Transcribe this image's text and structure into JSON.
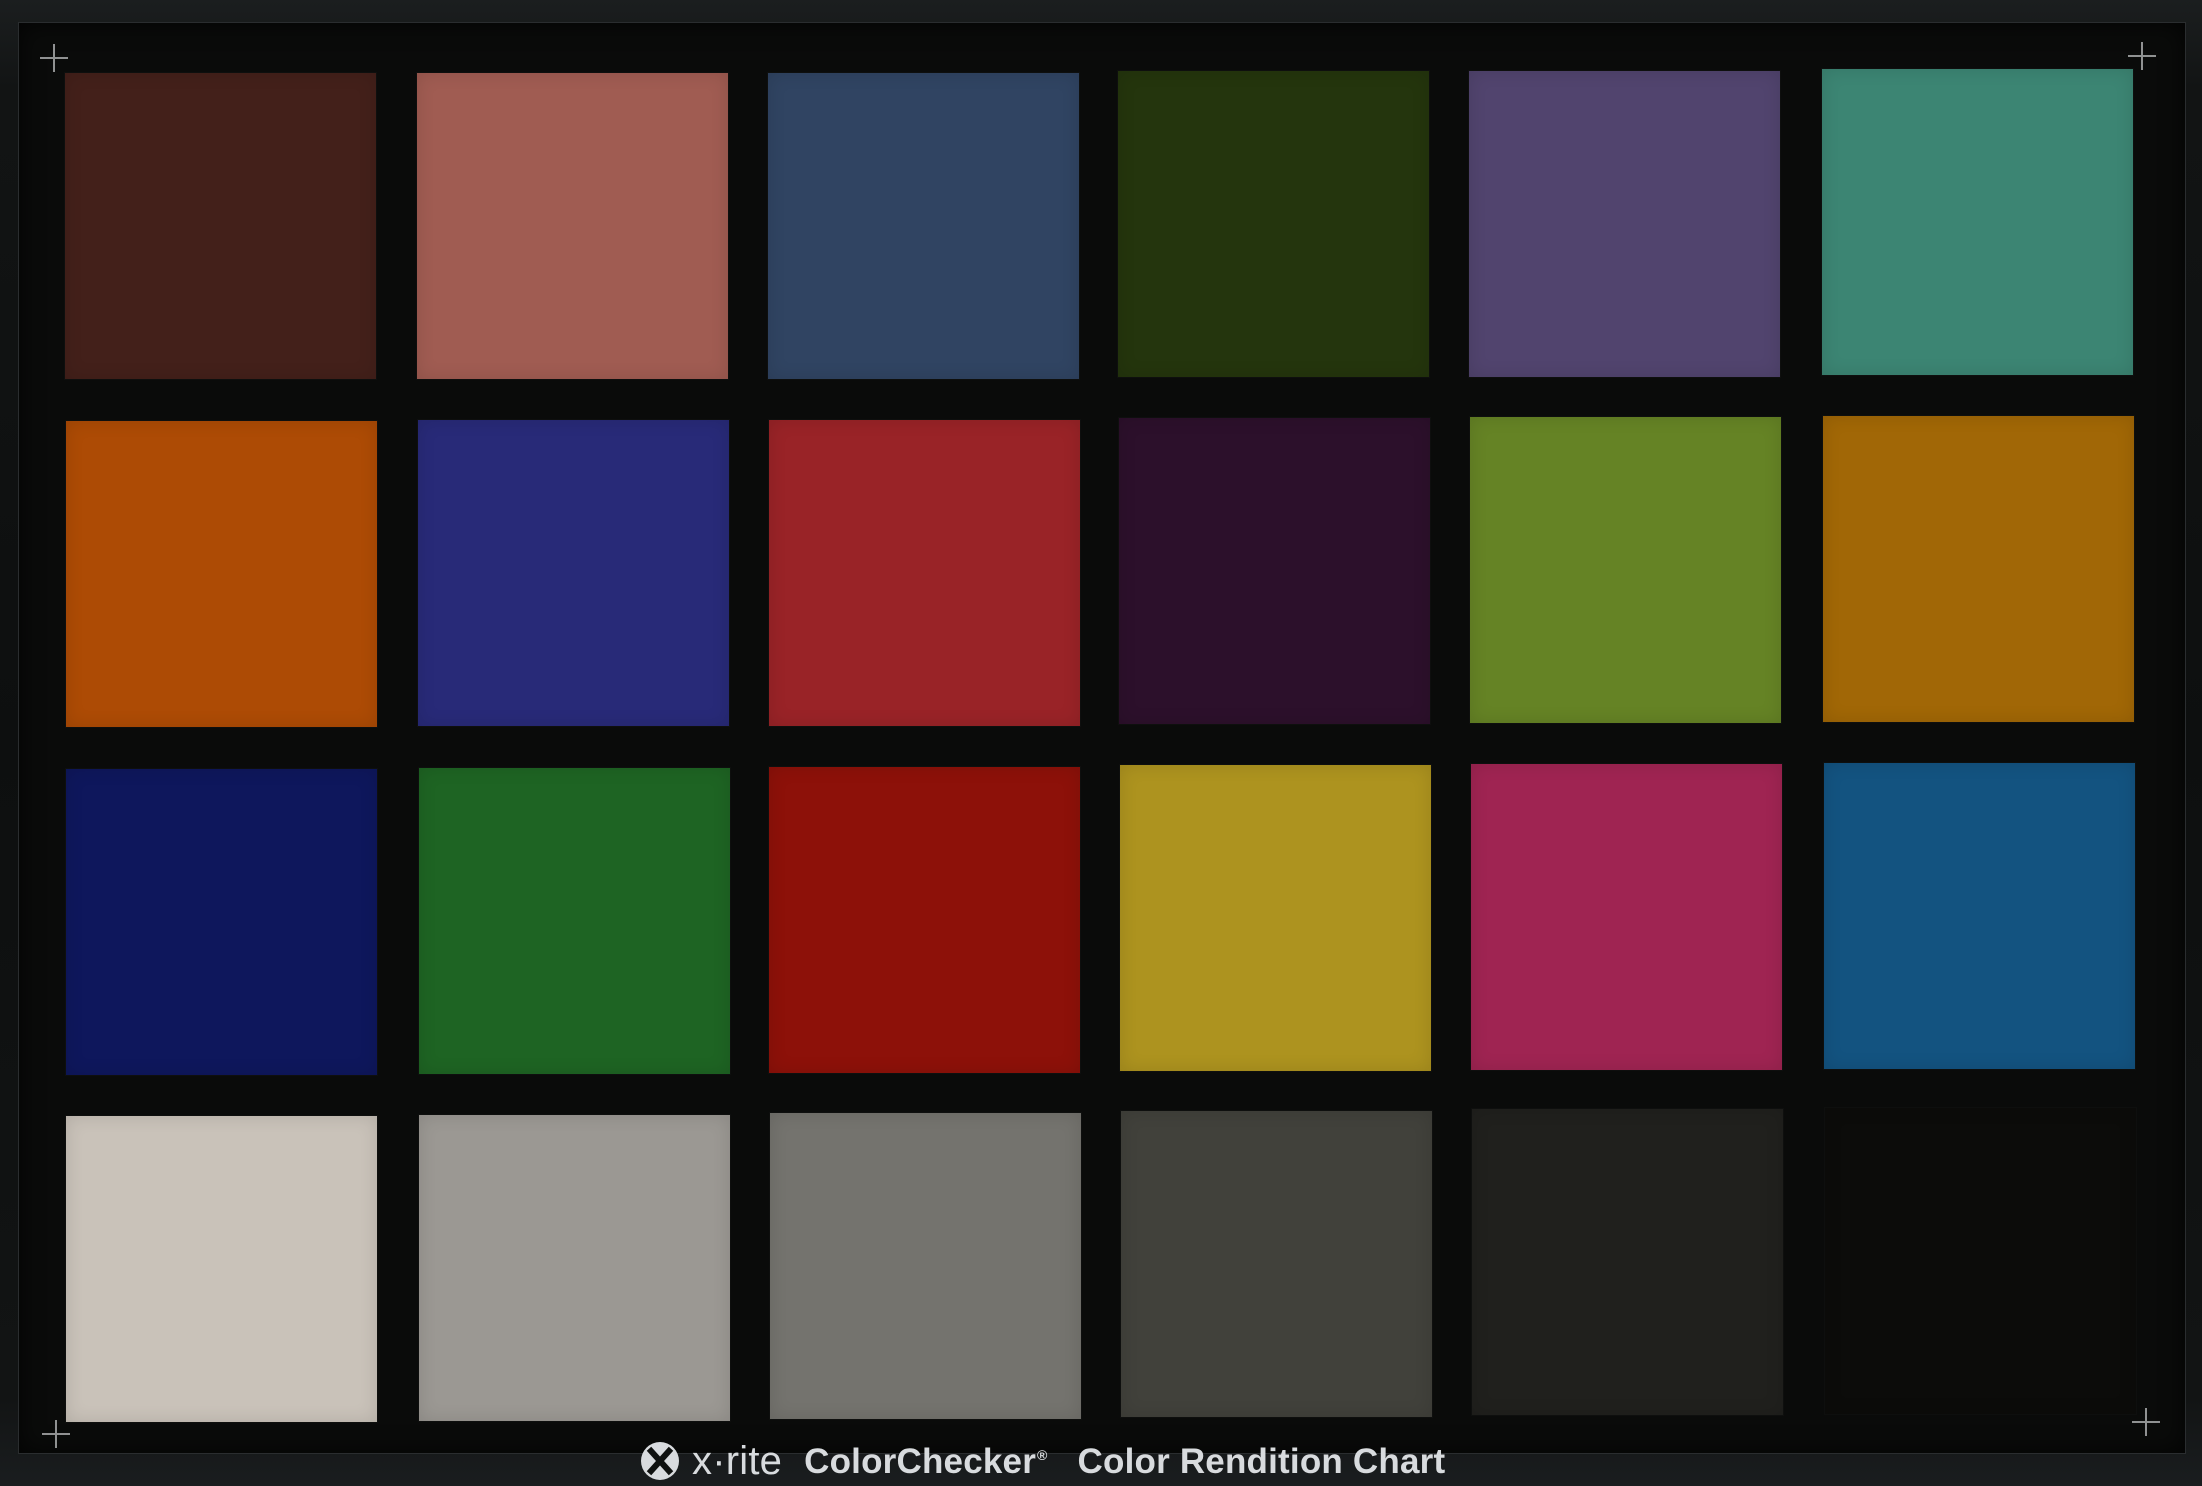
{
  "chart": {
    "brand": "x·rite",
    "product": "ColorChecker",
    "registered_mark": "®",
    "subtitle": "Color Rendition Chart"
  },
  "patches": [
    "#43201a",
    "#a05c52",
    "#304462",
    "#24350d",
    "#51446e",
    "#3c8573",
    "#ad4b05",
    "#282a78",
    "#992327",
    "#2c102b",
    "#658325",
    "#a16706",
    "#0e175c",
    "#1e6423",
    "#8d1109",
    "#ad931f",
    "#9f2452",
    "#135380",
    "#c9c2b9",
    "#9b9893",
    "#74736e",
    "#41413b",
    "#20201d",
    "#0c0c0a"
  ],
  "icons": {
    "logo": "x-rite-logo-icon",
    "crosshairs": [
      "crosshair-top-left-icon",
      "crosshair-top-right-icon",
      "crosshair-bottom-left-icon",
      "crosshair-bottom-right-icon"
    ]
  }
}
